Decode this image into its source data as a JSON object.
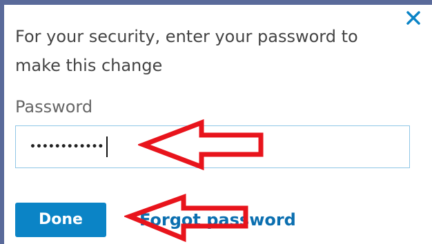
{
  "dialog": {
    "prompt": "For your security, enter your password to make this change",
    "password_label": "Password",
    "password_value": "••••••••••••",
    "done_label": "Done",
    "forgot_label": "Forgot password",
    "close_icon": "close-icon"
  },
  "annotations": {
    "arrow_color": "#e8141c",
    "arrows": [
      "red-arrow-pointing-at-password-field",
      "red-arrow-pointing-at-done-button"
    ]
  },
  "colors": {
    "accent": "#0b84c6",
    "link": "#0b6fb0",
    "frame": "#5a6a9a",
    "input_border": "#8fc6e6"
  }
}
